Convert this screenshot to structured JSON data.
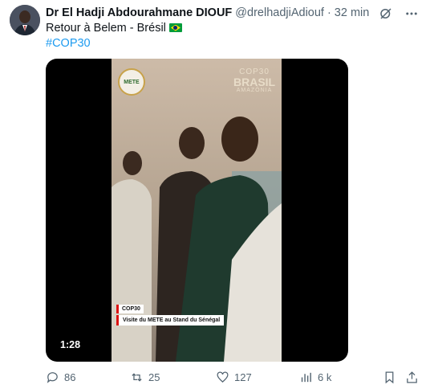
{
  "tweet": {
    "author_name": "Dr El Hadji Abdourahmane DIOUF",
    "handle": "@drelhadjiAdiouf",
    "separator": "·",
    "time": "32 min",
    "text": "Retour à Belem - Brésil",
    "flag_icon": "brazil-flag-icon",
    "hashtag": "#COP30"
  },
  "media": {
    "duration": "1:28",
    "logo_left": "METE",
    "logo_right": {
      "line1": "COP30",
      "line2": "BRASIL",
      "line3": "AMAZÔNIA"
    },
    "caption_tag": "COP30",
    "caption_text": "Visite du METE au Stand du Sénégal"
  },
  "actions": {
    "replies": "86",
    "reposts": "25",
    "likes": "127",
    "views": "6 k"
  },
  "colors": {
    "accent": "#1d9bf0",
    "muted": "#536471",
    "text": "#0f1419"
  }
}
